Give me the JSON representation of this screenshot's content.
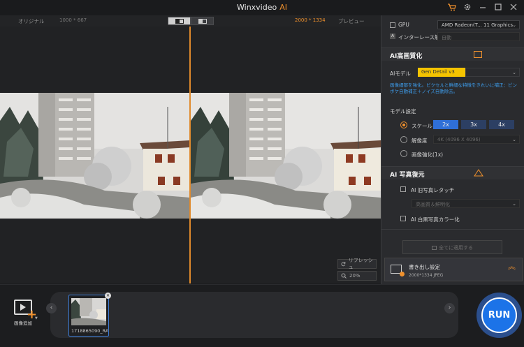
{
  "window": {
    "title": "Winxvideo",
    "title_accent": "AI"
  },
  "titlebar_icons": [
    "cart-icon",
    "gear-icon",
    "minimize-icon",
    "maximize-icon",
    "close-icon"
  ],
  "preview": {
    "original_label": "オリジナル",
    "original_resolution": "1000 * 667",
    "output_resolution": "2000 * 1334",
    "preview_label": "プレビュー",
    "refresh_label": "リフレッシュ",
    "zoom_label": "20%"
  },
  "settings": {
    "gpu_label": "GPU",
    "gpu_value": "AMD Radeon(T... 11 Graphics",
    "deinterlace_label": "インターレース解除",
    "deinterlace_value": "自動"
  },
  "upscale": {
    "title": "AI高画質化",
    "model_label": "AIモデル",
    "model_value": "Gen Detail v3",
    "description": "画像細部を強化。ピクセルと鮮細な特徴をきれいに補正：ピンボケ自動補正＋ノイズ自動除去。",
    "model_settings_label": "モデル設定",
    "scale_label": "スケール",
    "scale_options": [
      "2x",
      "3x",
      "4x"
    ],
    "scale_selected": "2x",
    "resolution_label": "解像度",
    "resolution_value": "4K (4096 X 4096)",
    "enhance_label": "画像強化(1x)"
  },
  "restore": {
    "title": "AI 写真復元",
    "old_photo_label": "AI 旧写真レタッチ",
    "old_photo_value": "高画質＆鮮明化",
    "colorize_label": "AI 白黒写真カラー化"
  },
  "apply_all_label": "全てに適用する",
  "export": {
    "title": "書き出し設定",
    "info": "2000*1334  JPEG"
  },
  "bottom": {
    "add_label": "画像追加",
    "thumbnail_name": "1718865090_RA",
    "run_label": "RUN"
  },
  "colors": {
    "accent": "#f0912d",
    "run_blue": "#1c73e8",
    "model_yellow": "#f5c400",
    "link_blue": "#3d9be9"
  }
}
